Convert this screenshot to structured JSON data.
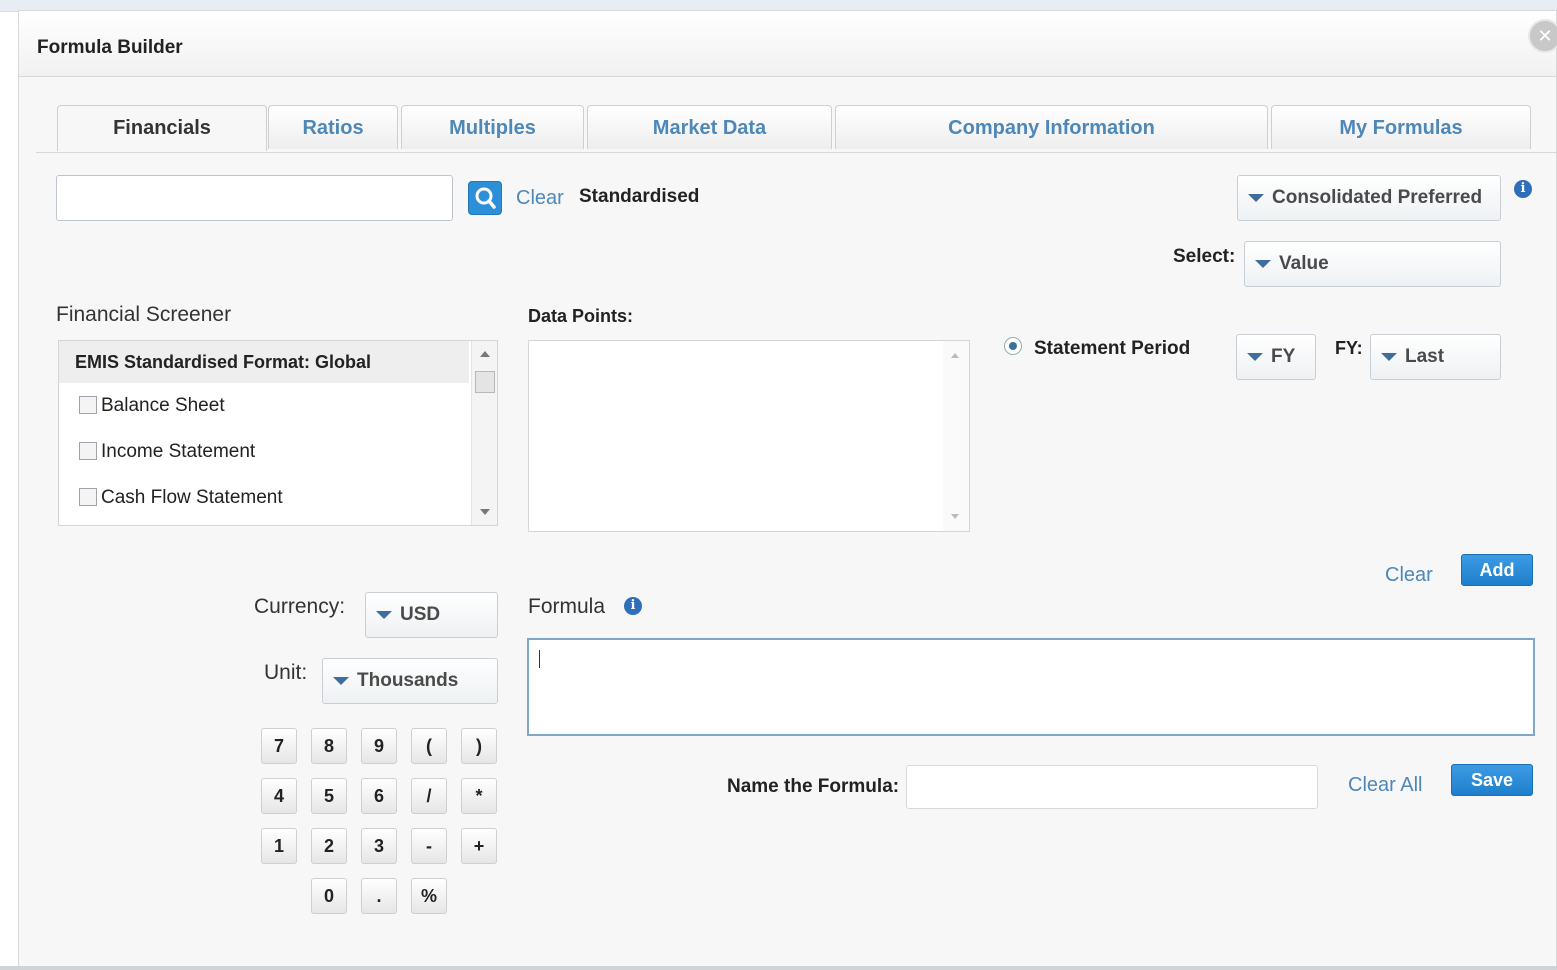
{
  "dialog": {
    "title": "Formula Builder"
  },
  "tabs": [
    {
      "label": "Financials",
      "active": true
    },
    {
      "label": "Ratios",
      "active": false
    },
    {
      "label": "Multiples",
      "active": false
    },
    {
      "label": "Market Data",
      "active": false
    },
    {
      "label": "Company Information",
      "active": false
    },
    {
      "label": "My Formulas",
      "active": false
    }
  ],
  "search": {
    "value": "",
    "clear_label": "Clear",
    "mode_label": "Standardised"
  },
  "consolidation": {
    "selected": "Consolidated Preferred"
  },
  "select_field": {
    "label": "Select:",
    "selected": "Value"
  },
  "screener": {
    "title": "Financial Screener",
    "header": "EMIS Standardised Format: Global",
    "items": [
      "Balance Sheet",
      "Income Statement",
      "Cash Flow Statement"
    ]
  },
  "data_points": {
    "label": "Data Points:"
  },
  "statement_period": {
    "label": "Statement Period",
    "period": "FY",
    "fy_label": "FY:",
    "fy_value": "Last"
  },
  "actions": {
    "clear_label": "Clear",
    "add_label": "Add"
  },
  "currency": {
    "label": "Currency:",
    "selected": "USD"
  },
  "unit": {
    "label": "Unit:",
    "selected": "Thousands"
  },
  "keypad": {
    "rows": [
      [
        "7",
        "8",
        "9",
        "(",
        ")"
      ],
      [
        "4",
        "5",
        "6",
        "/",
        "*"
      ],
      [
        "1",
        "2",
        "3",
        "-",
        "+"
      ],
      [
        "0",
        ".",
        "%"
      ]
    ]
  },
  "formula": {
    "label": "Formula",
    "value": ""
  },
  "name_formula": {
    "label": "Name the Formula:",
    "value": "",
    "clear_all_label": "Clear All",
    "save_label": "Save"
  },
  "colors": {
    "accent": "#2d8fd8",
    "link": "#4e88b8"
  },
  "icons": {
    "search": "search-icon",
    "info": "info-icon",
    "close": "close-icon"
  }
}
